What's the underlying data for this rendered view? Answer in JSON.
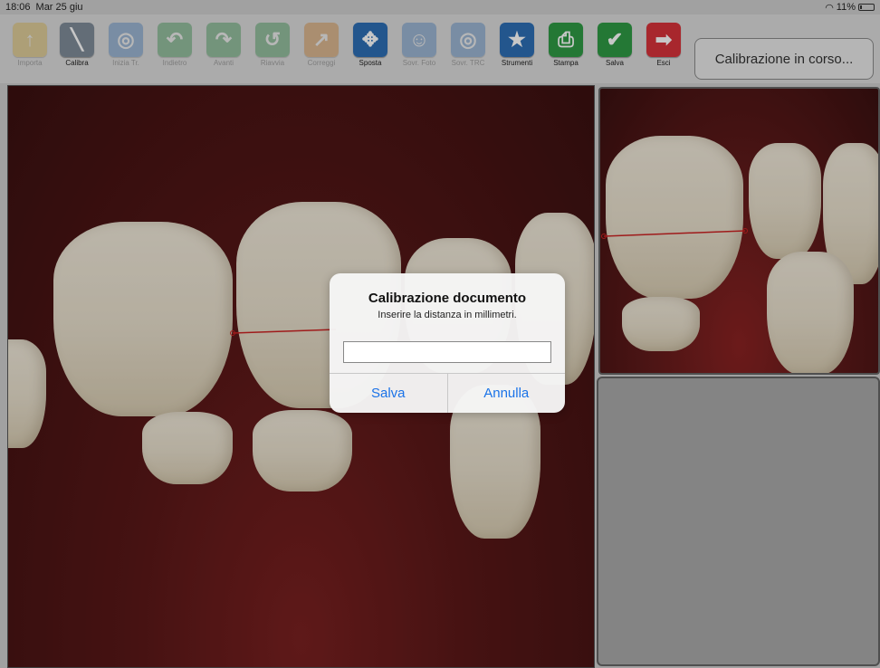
{
  "status_bar": {
    "time": "18:06",
    "date": "Mar 25 giu",
    "battery": "11%"
  },
  "toolbar": {
    "items": [
      {
        "label": "Importa",
        "icon": "folder-import-icon",
        "color": "#e1b94a",
        "enabled": false
      },
      {
        "label": "Calibra",
        "icon": "ruler-calibrate-icon",
        "color": "#7f8c99",
        "enabled": true
      },
      {
        "label": "Inizia Tr.",
        "icon": "start-trace-icon",
        "color": "#4f86c6",
        "enabled": false
      },
      {
        "label": "Indietro",
        "icon": "undo-icon",
        "color": "#3f9b54",
        "enabled": false
      },
      {
        "label": "Avanti",
        "icon": "redo-icon",
        "color": "#3f9b54",
        "enabled": false
      },
      {
        "label": "Riavvia",
        "icon": "restart-icon",
        "color": "#3f9b54",
        "enabled": false
      },
      {
        "label": "Correggi",
        "icon": "correct-icon",
        "color": "#d88a36",
        "enabled": false
      },
      {
        "label": "Sposta",
        "icon": "move-arrows-icon",
        "color": "#2e6fb5",
        "enabled": true
      },
      {
        "label": "Sovr. Foto",
        "icon": "overlay-photo-icon",
        "color": "#4f86c6",
        "enabled": false
      },
      {
        "label": "Sovr. TRC",
        "icon": "overlay-trc-icon",
        "color": "#4f86c6",
        "enabled": false
      },
      {
        "label": "Strumenti",
        "icon": "magic-wand-icon",
        "color": "#2e6fb5",
        "enabled": true
      },
      {
        "label": "Stampa",
        "icon": "printer-icon",
        "color": "#2f9a45",
        "enabled": true
      },
      {
        "label": "Salva",
        "icon": "save-check-icon",
        "color": "#2f9a45",
        "enabled": true
      },
      {
        "label": "Esci",
        "icon": "exit-icon",
        "color": "#d8333a",
        "enabled": true
      }
    ]
  },
  "status_box": {
    "text": "Calibrazione in corso..."
  },
  "dialog": {
    "title": "Calibrazione documento",
    "message": "Inserire la distanza in millimetri.",
    "input_value": "",
    "confirm_label": "Salva",
    "cancel_label": "Annulla"
  }
}
